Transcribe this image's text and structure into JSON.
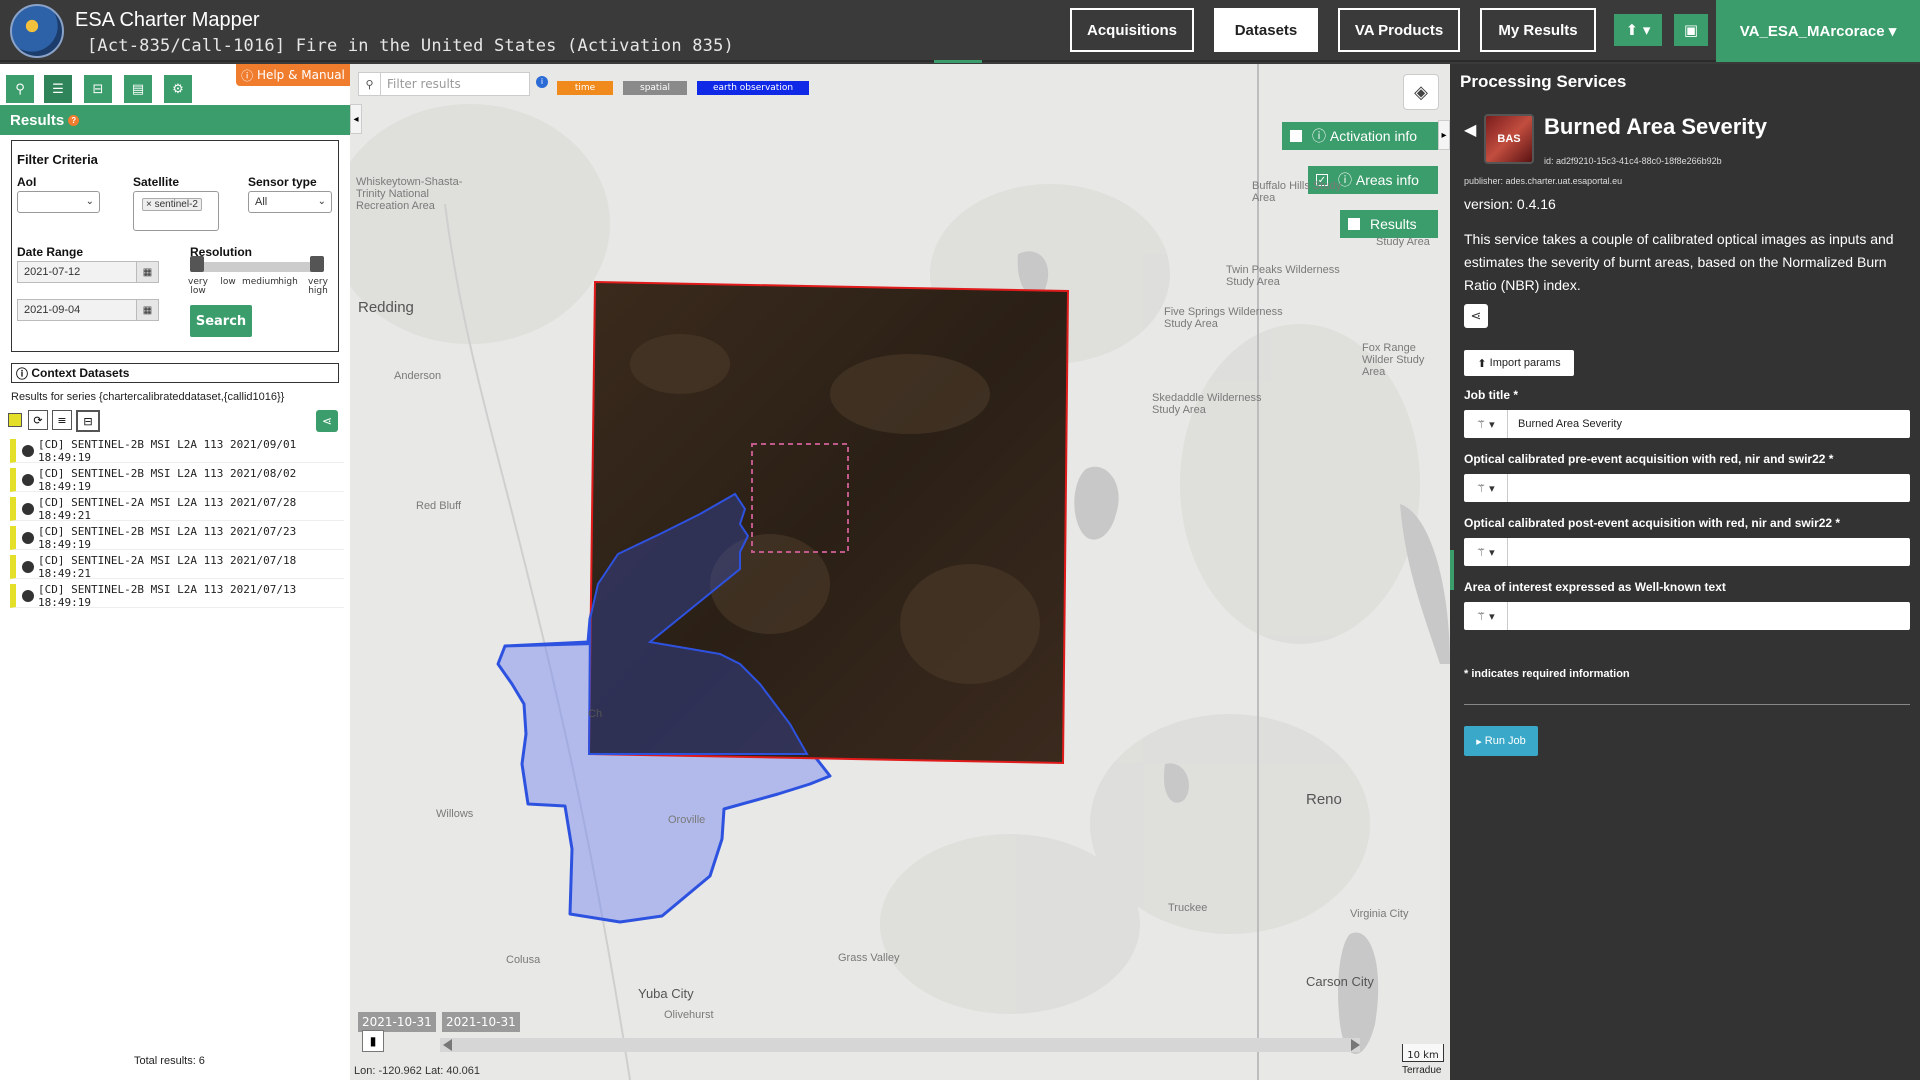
{
  "header": {
    "app_title": "ESA Charter Mapper",
    "activation_title": "[Act-835/Call-1016] Fire in the United States (Activation 835)",
    "nav": {
      "acquisitions": "Acquisitions",
      "datasets": "Datasets",
      "va_products": "VA Products",
      "my_results": "My Results"
    },
    "user": "VA_ESA_MArcorace ▾",
    "upload_icon": "upload-icon",
    "briefcase_icon": "briefcase-icon"
  },
  "left": {
    "help": "Help & Manual",
    "results_title": "Results",
    "filter": {
      "title": "Filter Criteria",
      "aoi_label": "AoI",
      "aoi_value": "",
      "satellite_label": "Satellite",
      "satellite_tag": "× sentinel-2",
      "sensor_label": "Sensor type",
      "sensor_value": "All",
      "date_label": "Date Range",
      "date_from": "2021-07-12",
      "date_to": "2021-09-04",
      "resolution_label": "Resolution",
      "res_ticks": [
        "very low",
        "low",
        "medium",
        "high",
        "very high"
      ],
      "search": "Search"
    },
    "context_datasets": "Context Datasets",
    "series_text": "Results for series {chartercalibrateddataset,{callid1016}}",
    "results": [
      "[CD] SENTINEL-2B MSI L2A 113 2021/09/01 18:49:19",
      "[CD] SENTINEL-2B MSI L2A 113 2021/08/02 18:49:19",
      "[CD] SENTINEL-2A MSI L2A 113 2021/07/28 18:49:21",
      "[CD] SENTINEL-2B MSI L2A 113 2021/07/23 18:49:19",
      "[CD] SENTINEL-2A MSI L2A 113 2021/07/18 18:49:21",
      "[CD] SENTINEL-2B MSI L2A 113 2021/07/13 18:49:19"
    ],
    "total": "Total results: 6"
  },
  "map": {
    "filter_placeholder": "Filter results",
    "chips": {
      "time": "time",
      "spatial": "spatial",
      "eo": "earth observation"
    },
    "tabs": {
      "activation": "Activation info",
      "areas": "Areas info",
      "results": "Results"
    },
    "places": {
      "whiskeytown": "Whiskeytown-Shasta-Trinity National Recreation Area",
      "redding": "Redding",
      "anderson": "Anderson",
      "red_bluff": "Red Bluff",
      "willows": "Willows",
      "oroville": "Oroville",
      "colusa": "Colusa",
      "yuba": "Yuba City",
      "olivehurst": "Olivehurst",
      "grass_valley": "Grass Valley",
      "truckee": "Truckee",
      "reno": "Reno",
      "virginia_city": "Virginia City",
      "carson_city": "Carson City",
      "buffalo_hills": "Buffalo Hills Study Area",
      "twin_peaks": "Twin Peaks Wilderness Study Area",
      "five_springs": "Five Springs Wilderness Study Area",
      "fox_range": "Fox Range Wilder Study Area",
      "skedaddle": "Skedaddle Wilderness Study Area",
      "study_area": "Study Area",
      "ch": "Ch"
    },
    "timeline": [
      "2021-10-31",
      "2021-10-31"
    ],
    "coords": "Lon: -120.962 Lat: 40.061",
    "scale": "10 km",
    "attribution": "Terradue"
  },
  "right": {
    "title": "Processing Services",
    "service_name": "Burned Area Severity",
    "thumb": "BAS",
    "service_id": "id: ad2f9210-15c3-41c4-88c0-18f8e266b92b",
    "publisher": "publisher: ades.charter.uat.esaportal.eu",
    "version": "version: 0.4.16",
    "description": "This service takes a couple of calibrated optical images as inputs and estimates the severity of burnt areas, based on the Normalized Burn Ratio (NBR) index.",
    "import": "Import params",
    "params": [
      {
        "label": "Job title *",
        "value": "Burned Area Severity"
      },
      {
        "label": "Optical calibrated pre-event acquisition with red, nir and swir22 *",
        "value": ""
      },
      {
        "label": "Optical calibrated post-event acquisition with red, nir and swir22 *",
        "value": ""
      },
      {
        "label": "Area of interest expressed as Well-known text",
        "value": ""
      }
    ],
    "required_note": "* indicates required information",
    "run": "Run Job"
  },
  "colors": {
    "accent": "#3a9d6b",
    "orange": "#f07c2e",
    "aoi": "#2e52e0",
    "footprint": "#e01b1b"
  }
}
